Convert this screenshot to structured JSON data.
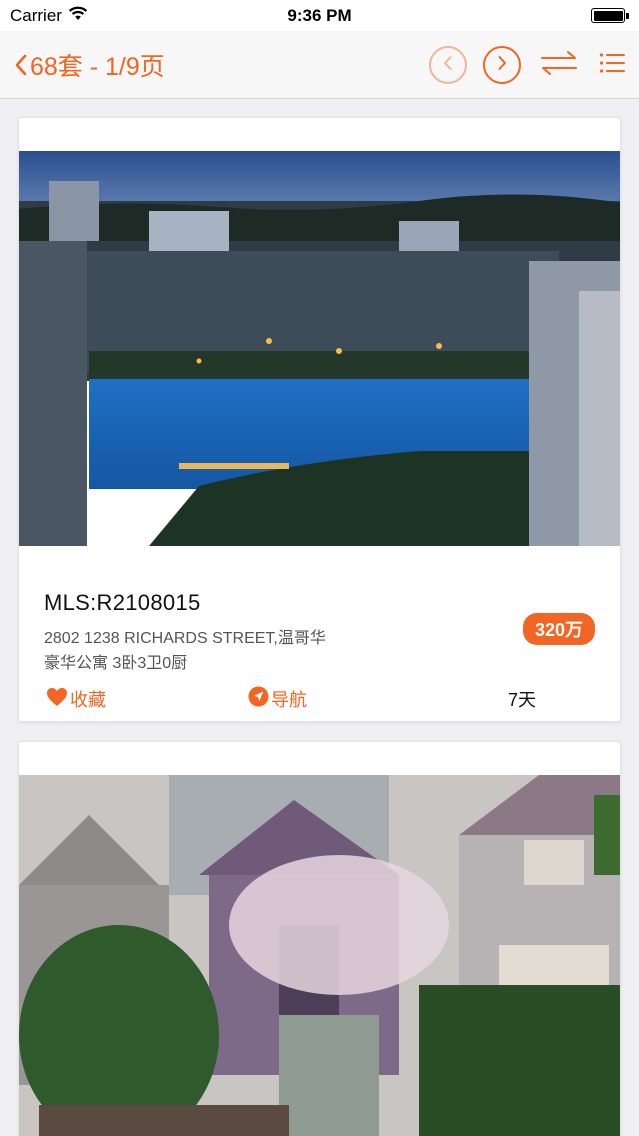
{
  "status_bar": {
    "carrier": "Carrier",
    "time": "9:36 PM",
    "wifi_icon": "wifi-icon",
    "battery_icon": "battery-icon"
  },
  "nav": {
    "back_icon": "chevron-left-icon",
    "title": "68套 - 1/9页",
    "prev_icon": "chevron-left-circle-icon",
    "next_icon": "chevron-right-circle-icon",
    "sort_icon": "swap-arrows-icon",
    "list_icon": "list-icon"
  },
  "colors": {
    "accent": "#f26522",
    "accent_light": "#f6b393",
    "background": "#efeff4",
    "card": "#ffffff"
  },
  "listings": [
    {
      "mls": "MLS:R2108015",
      "address": "2802 1238 RICHARDS STREET,温哥华",
      "details": "豪华公寓 3卧3卫0厨",
      "price": "320万",
      "favorite_label": "收藏",
      "favorite_icon": "heart-icon",
      "navigate_label": "导航",
      "navigate_icon": "navigation-arrow-icon",
      "days": "7天"
    }
  ]
}
